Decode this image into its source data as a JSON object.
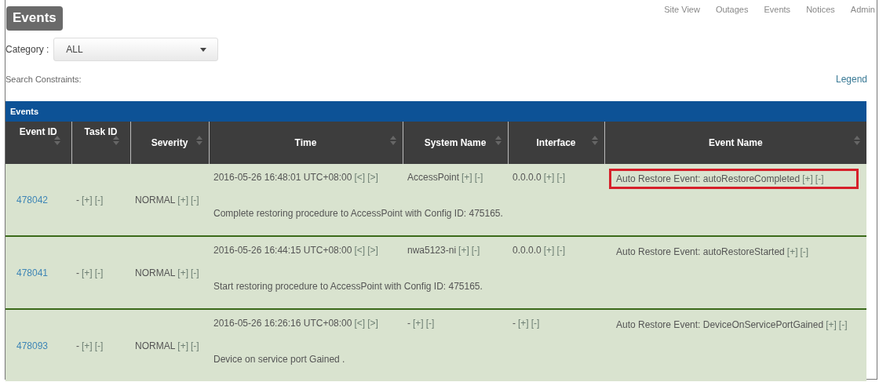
{
  "title": "Events",
  "nav": [
    "Site View",
    "Outages",
    "Events",
    "Notices",
    "Admin"
  ],
  "category": {
    "label": "Category :",
    "value": "ALL"
  },
  "search_constraints": "Search Constraints:",
  "legend": "Legend",
  "table": {
    "title": "Events",
    "columns": [
      "Event ID",
      "Task ID",
      "Severity",
      "Time",
      "System Name",
      "Interface",
      "Event Name"
    ],
    "rows": [
      {
        "event_id": "478042",
        "task_id": {
          "text": "-",
          "links": [
            "[+]",
            "[-]"
          ]
        },
        "severity": {
          "text": "NORMAL",
          "links": [
            "[+]",
            "[-]"
          ]
        },
        "time": {
          "text": "2016-05-26 16:48:01 UTC+08:00",
          "links": [
            "[<]",
            "[>]"
          ]
        },
        "system_name": {
          "text": "AccessPoint",
          "links": [
            "[+]",
            "[-]"
          ]
        },
        "interface": {
          "text": "0.0.0.0",
          "links": [
            "[+]",
            "[-]"
          ]
        },
        "event_name": {
          "text": "Auto Restore Event: autoRestoreCompleted",
          "links": [
            "[+]",
            "[-]"
          ]
        },
        "highlighted": true,
        "description": "Complete restoring procedure to AccessPoint with Config ID: 475165."
      },
      {
        "event_id": "478041",
        "task_id": {
          "text": "-",
          "links": [
            "[+]",
            "[-]"
          ]
        },
        "severity": {
          "text": "NORMAL",
          "links": [
            "[+]",
            "[-]"
          ]
        },
        "time": {
          "text": "2016-05-26 16:44:15 UTC+08:00",
          "links": [
            "[<]",
            "[>]"
          ]
        },
        "system_name": {
          "text": "nwa5123-ni",
          "links": [
            "[+]",
            "[-]"
          ]
        },
        "interface": {
          "text": "0.0.0.0",
          "links": [
            "[+]",
            "[-]"
          ]
        },
        "event_name": {
          "text": "Auto Restore Event: autoRestoreStarted",
          "links": [
            "[+]",
            "[-]"
          ]
        },
        "highlighted": false,
        "description": "Start restoring procedure to AccessPoint with Config ID: 475165."
      },
      {
        "event_id": "478093",
        "task_id": {
          "text": "-",
          "links": [
            "[+]",
            "[-]"
          ]
        },
        "severity": {
          "text": "NORMAL",
          "links": [
            "[+]",
            "[-]"
          ]
        },
        "time": {
          "text": "2016-05-26 16:26:16 UTC+08:00",
          "links": [
            "[<]",
            "[>]"
          ]
        },
        "system_name": {
          "text": "-",
          "links": [
            "[+]",
            "[-]"
          ]
        },
        "interface": {
          "text": "-",
          "links": [
            "[+]",
            "[-]"
          ]
        },
        "event_name": {
          "text": "Auto Restore Event: DeviceOnServicePortGained",
          "links": [
            "[+]",
            "[-]"
          ]
        },
        "highlighted": false,
        "description": "Device on service port Gained ."
      }
    ]
  }
}
